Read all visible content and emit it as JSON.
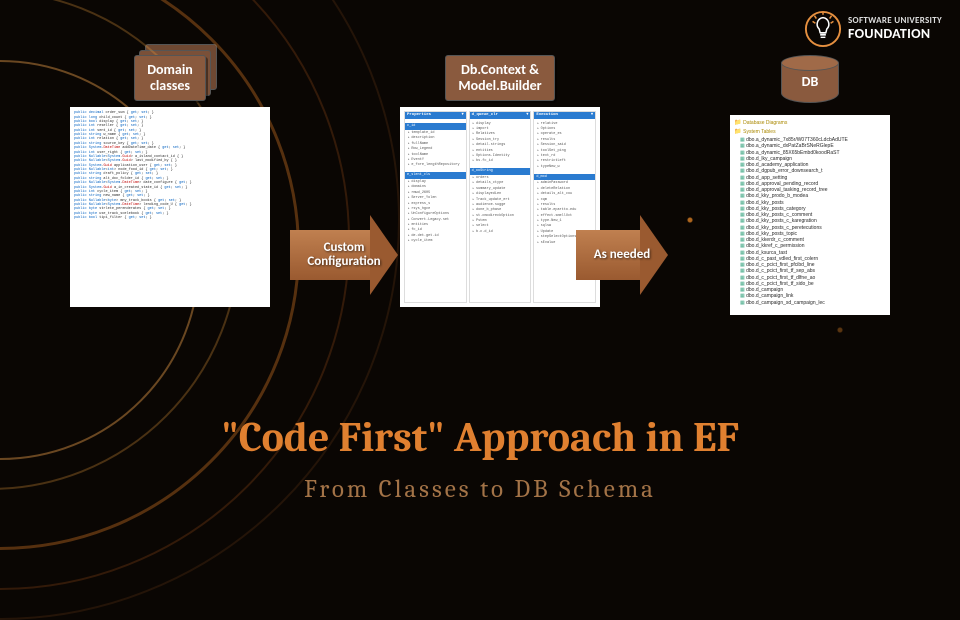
{
  "logo": {
    "line1": "SOFTWARE UNIVERSITY",
    "line2": "FOUNDATION"
  },
  "badges": {
    "domain": "Domain\nclasses",
    "context": "Db.Context &\nModel.Builder",
    "db": "DB"
  },
  "arrows": {
    "custom": "Custom\nConfiguration",
    "asneeded": "As needed"
  },
  "code_panel": {
    "lines": [
      "public decimal order_sum { get; set; }",
      "public long child_count { get; set; }",
      "public bool display { get; set; }",
      "public int reseller { get; set; }",
      "public int sent_id { get; set; }",
      "public string w_name { get; set; }",
      "public int relation { get; set; }",
      "public string source_key { get; set; }",
      "public System.DateTime addDateTime_date { get; set; }",
      "public int user_right { get; set; }",
      "public Nullable<System.Guid> a_island_contact_id { }",
      "public Nullable<System.Guid> last_modified_by { }",
      "public System.Guid application_user { get; set; }",
      "public Nullable<int> node_food_id { get; set; }",
      "public string draft_policy { get; set; }",
      "public string alt_doc_folder_id { get; set; }",
      "public Nullable<System.DateTime> date_configure { get; }",
      "public System.Guid a_in_created_state_id { get; set; }",
      "public int cycle_item { get; set; }",
      "public string new_name { get; set; }",
      "public Nullable<byte> mny_track_books { get; set; }",
      "public Nullable<System.DateTime> lending_code_U { get; }",
      "public byte strlete_perenderates { get; set; }",
      "public byte use_track_scelebook { get; set; }",
      "public bool tipi_filter { get; set; }"
    ]
  },
  "db_tree": {
    "root1": "Database Diagrams",
    "root2": "System Tables",
    "tables": [
      "dbo.a_dynamic_7x85r/W07T360cLdcbAdUTE",
      "dbo.a_dynamic_dxPatZaBrSNeRGlepE",
      "dbo.a_dynamic_85X65bEmbd0koodRaST",
      "dbo.d_lky_campaign",
      "dbo.d_academy_application",
      "dbo.d_dgpub_error_downsearch_t",
      "dbo.d_app_setting",
      "dbo.d_approval_pending_record",
      "dbo.d_approval_tasking_record_tree",
      "dbo.d_kky_prodo_b_modea",
      "dbo.d_kky_posts",
      "dbo.d_kky_posts_category",
      "dbo.d_kky_posts_c_comment",
      "dbo.d_kky_posts_c_karegration",
      "dbo.d_kky_posts_c_peretecutions",
      "dbo.d_kky_posts_topic",
      "dbo.d_kkerdr_c_comment",
      "dbo.d_kkref_c_permission",
      "dbo.d_ksurca_tast",
      "dbo.d_c_past_vdled_first_colern",
      "dbo.d_c_pcict_first_pfcibd_line",
      "dbo.d_c_pcict_first_tf_sep_abs",
      "dbo.d_c_pcict_first_tf_dlfne_ao",
      "dbo.d_c_pcict_first_tf_sido_be",
      "dbo.d_campaign",
      "dbo.d_campaign_link",
      "dbo.d_campaign_sd_campaign_lec"
    ]
  },
  "mid_panel": {
    "cols": [
      {
        "hdr": "Properties",
        "sub1": "c_id",
        "items": [
          "template_id",
          "description",
          "fullName",
          "Row_Legend",
          "toolName",
          "EventY",
          "e_fore_lengthRepository"
        ],
        "sub2": "e_slent_cls",
        "items2": [
          "display",
          "domains",
          "rmwd_2605",
          "Server_Yolen",
          "express_s",
          "rsys_hgce",
          "UnConfigureOptions",
          "Convert.Legacy.set",
          "entities",
          "fc_id",
          "de.det.get.id",
          "cycle_item"
        ]
      },
      {
        "hdr": "d_queue_clr",
        "items": [
          "display",
          "import",
          "Relatives",
          "Session_try",
          "detail.strings",
          "entities",
          "Options.Identity",
          "bs.fc_id"
        ],
        "sub2": "d_ooString",
        "items2": [
          "orders",
          "details_ctype",
          "summary_update",
          "displayedLen",
          "Track_update_ert",
          "audience.sugge",
          "done_b_phase",
          "st.cmodireckOption",
          "Pstem",
          "select",
          "b.c.d_id"
        ]
      },
      {
        "hdr": "Execution",
        "items": [
          "relative",
          "Options",
          "operate_es",
          "results",
          "Session_said",
          "toolSet_ping",
          "text_rd",
          "restrictLeft",
          "typeNew_w"
        ],
        "sub2": "d_mod",
        "items2": [
          "adminPassword",
          "deleteRelation",
          "details_alt_cou",
          "xqm",
          "results",
          "table.epartto.edu",
          "effect.smellUct",
          "type.New_1",
          "sqlsw",
          "Update",
          "stepSelectOptions",
          "sEvalue"
        ]
      }
    ]
  },
  "titles": {
    "main": "\"Code First\" Approach in EF",
    "sub": "From Classes to DB Schema"
  }
}
